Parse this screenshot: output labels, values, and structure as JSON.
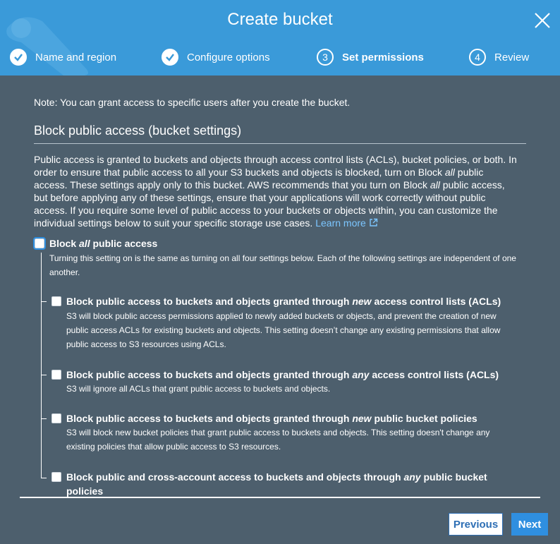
{
  "header": {
    "title": "Create bucket",
    "steps": [
      {
        "label": "Name and region",
        "state": "done"
      },
      {
        "label": "Configure options",
        "state": "done"
      },
      {
        "label": "Set permissions",
        "number": "3",
        "state": "active"
      },
      {
        "label": "Review",
        "number": "4",
        "state": "pending"
      }
    ]
  },
  "main": {
    "note": "Note: You can grant access to specific users after you create the bucket.",
    "section_title": "Block public access (bucket settings)",
    "intro": {
      "line1": "Public access is granted to buckets and objects through access control lists (ACLs), bucket policies, or both. In",
      "line2": "order to ensure that public access to all your S3 buckets and objects is blocked, turn on Block",
      "line2_em": "all",
      "line2_end": "public",
      "line3": "access. These settings apply only to this bucket. AWS recommends that you turn on Block",
      "line3_em": "all",
      "line3_end": "public access,",
      "line4": "but before applying any of these settings, ensure that your applications will work correctly without public",
      "line5": "access. If you require some level of public access to your buckets or objects within, you can customize the",
      "line6": "individual settings below to suit your specific storage use cases.",
      "learn_more": "Learn more"
    },
    "block_all": {
      "title_pre": "Block",
      "title_em": "all",
      "title_post": "public access",
      "desc_line1": "Turning this setting on is the same as turning on all four settings below. Each of the following settings are independent of one",
      "desc_line2": "another.",
      "checked": false
    },
    "options": [
      {
        "title_pre": "Block public access to buckets and objects granted through",
        "title_em": "new",
        "title_post": "access control lists (ACLs)",
        "desc_line1": "S3 will block public access permissions applied to newly added buckets or objects, and prevent the creation of new",
        "desc_line2": "public access ACLs for existing buckets and objects. This setting doesn’t change any existing permissions that allow",
        "desc_line3": "public access to S3 resources using ACLs.",
        "checked": false
      },
      {
        "title_pre": "Block public access to buckets and objects granted through",
        "title_em": "any",
        "title_post": "access control lists (ACLs)",
        "desc_line1": "S3 will ignore all ACLs that grant public access to buckets and objects.",
        "checked": false
      },
      {
        "title_pre": "Block public access to buckets and objects granted through",
        "title_em": "new",
        "title_post": "public bucket policies",
        "desc_line1": "S3 will block new bucket policies that grant public access to buckets and objects. This setting doesn't change any",
        "desc_line2": "existing policies that allow public access to S3 resources.",
        "checked": false
      },
      {
        "title_pre": "Block public and cross-account access to buckets and objects through",
        "title_em": "any",
        "title_post": "public bucket",
        "title_line2": "policies",
        "checked": false
      }
    ]
  },
  "footer": {
    "previous_label": "Previous",
    "next_label": "Next"
  },
  "colors": {
    "header_bg": "#3a9ad9",
    "body_bg": "#4d5f6d",
    "link": "#7cc6ff",
    "primary_button": "#2f8fe0"
  },
  "icons": [
    "check-icon",
    "close-icon",
    "external-link-icon"
  ]
}
